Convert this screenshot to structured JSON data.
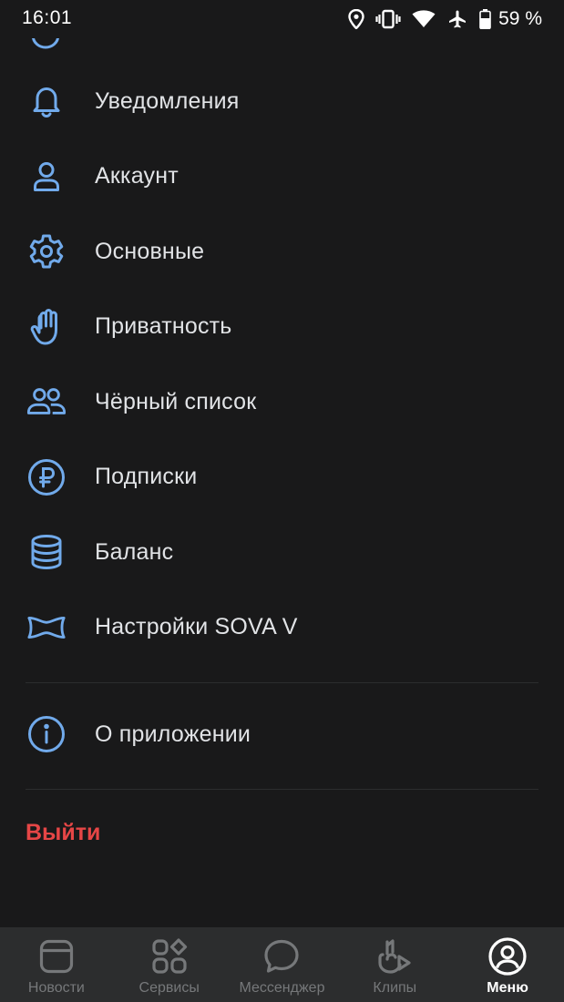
{
  "status_bar": {
    "time": "16:01",
    "battery": "59 %",
    "icons": [
      "location-icon",
      "vibrate-icon",
      "wifi-icon",
      "airplane-icon",
      "battery-icon"
    ]
  },
  "colors": {
    "background": "#19191a",
    "accent_icon": "#71aaeb",
    "text": "#e1e3e6",
    "logout": "#e64646",
    "tabbar_bg": "#2c2d2e",
    "tab_inactive": "#76787a"
  },
  "menu": {
    "items": [
      {
        "label": "Уведомления",
        "icon": "bell-icon"
      },
      {
        "label": "Аккаунт",
        "icon": "user-icon"
      },
      {
        "label": "Основные",
        "icon": "gear-icon"
      },
      {
        "label": "Приватность",
        "icon": "hand-icon"
      },
      {
        "label": "Чёрный список",
        "icon": "users-icon"
      },
      {
        "label": "Подписки",
        "icon": "ruble-icon"
      },
      {
        "label": "Баланс",
        "icon": "coins-stack-icon"
      },
      {
        "label": "Настройки SOVA V",
        "icon": "bowtie-icon"
      }
    ],
    "about": {
      "label": "О приложении",
      "icon": "info-icon"
    },
    "logout": "Выйти"
  },
  "tabbar": {
    "tabs": [
      {
        "label": "Новости",
        "icon": "news-icon",
        "active": false
      },
      {
        "label": "Сервисы",
        "icon": "services-icon",
        "active": false
      },
      {
        "label": "Мессенджер",
        "icon": "messenger-icon",
        "active": false
      },
      {
        "label": "Клипы",
        "icon": "clips-icon",
        "active": false
      },
      {
        "label": "Меню",
        "icon": "profile-menu-icon",
        "active": true
      }
    ]
  }
}
